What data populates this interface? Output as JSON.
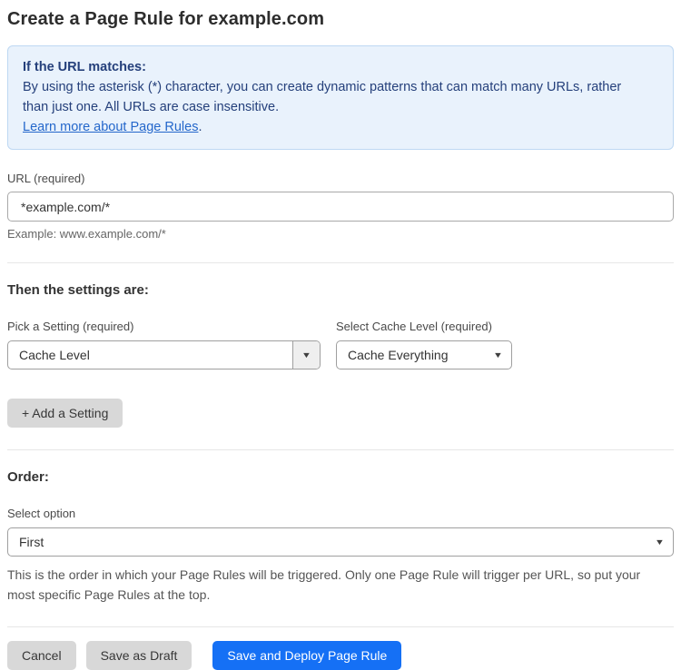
{
  "page": {
    "title": "Create a Page Rule for example.com"
  },
  "info_box": {
    "heading": "If the URL matches:",
    "body": "By using the asterisk (*) character, you can create dynamic patterns that can match many URLs, rather than just one. All URLs are case insensitive.",
    "link_label": "Learn more about Page Rules",
    "link_suffix": "."
  },
  "url_field": {
    "label": "URL (required)",
    "value": "*example.com/*",
    "helper": "Example: www.example.com/*"
  },
  "settings_section": {
    "heading": "Then the settings are:",
    "setting_picker": {
      "label": "Pick a Setting (required)",
      "value": "Cache Level"
    },
    "cache_level_picker": {
      "label": "Select Cache Level (required)",
      "value": "Cache Everything"
    },
    "add_setting_label": "+ Add a Setting"
  },
  "order_section": {
    "heading": "Order:",
    "select_label": "Select option",
    "value": "First",
    "helper": "This is the order in which your Page Rules will be triggered. Only one Page Rule will trigger per URL, so put your most specific Page Rules at the top."
  },
  "footer": {
    "cancel_label": "Cancel",
    "save_draft_label": "Save as Draft",
    "save_deploy_label": "Save and Deploy Page Rule"
  },
  "icons": {
    "dropdown_arrow": "▼"
  },
  "colors": {
    "info_background": "#e9f2fc",
    "info_border": "#bed8f3",
    "info_text": "#25407b",
    "link_blue": "#2467cb",
    "primary_button_blue": "#1570f5",
    "gray_button": "#d8d8d8"
  }
}
